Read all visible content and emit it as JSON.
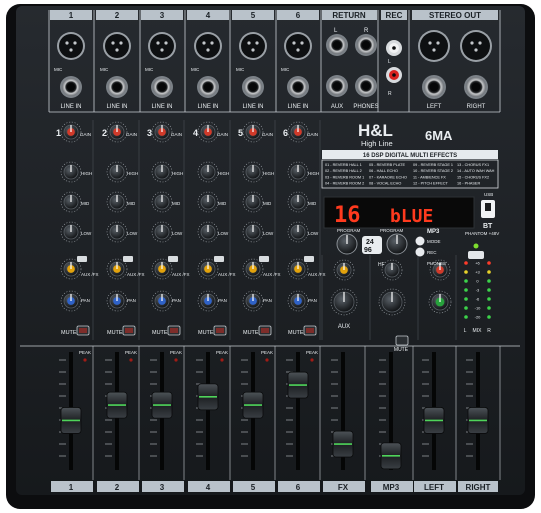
{
  "brand": {
    "logo": "H&L",
    "name": "High Line",
    "model": "6MA"
  },
  "top_labels": {
    "channels": [
      "1",
      "2",
      "3",
      "4",
      "5",
      "6"
    ],
    "return": "RETURN",
    "rec": "REC",
    "stereo_out": "STEREO OUT"
  },
  "jack_labels": {
    "mic": "MIC",
    "line_in": "LINE IN",
    "aux": "AUX",
    "phones": "PHONES",
    "left": "LEFT",
    "right": "RIGHT",
    "rec_l": "L",
    "rec_r": "R"
  },
  "channel_strip": {
    "gain": "GAIN",
    "high": "HIGH",
    "mid": "MID",
    "low": "LOW",
    "aux_fx": "AUX /FX",
    "pan": "PAN",
    "mute": "MUTE",
    "peak": "PEAK"
  },
  "effects": {
    "title": "16 DSP DIGITAL MULTI EFFECTS",
    "list": [
      "01 - REVERB HALL 1",
      "02 - REVERB HALL 2",
      "03 - REVERB ROOM 1",
      "04 - REVERB ROOM 2",
      "05 - REVERB PLATE",
      "06 - HALL ECHO",
      "07 - KARAOKE ECHO",
      "08 - VOCAL ECHO",
      "09 - REVERB STAGE 1",
      "10 - REVERB STAGE 2",
      "11 - AMBIENCE FX",
      "12 - PITCH EFFECT",
      "13 - CHORUS FX1",
      "14 - AUTO WAH WAH",
      "15 - CHORUS FX2",
      "16 - PHASER"
    ]
  },
  "display": {
    "preset": "16",
    "mode": "bLUE"
  },
  "controls": {
    "program_left": "PROGRAM",
    "program_right": "PROGRAM",
    "mp3": "MP3",
    "mode": "MODE",
    "rec": "REC",
    "usb": "USB",
    "bt": "BT",
    "phantom": "PHANTOM +48V",
    "aux": "AUX",
    "phones": "PHONES",
    "hf": "HF",
    "db24": "24",
    "bit96": "96"
  },
  "meter": {
    "labels": [
      "+6",
      "+3",
      "0",
      "-3",
      "-6",
      "-10",
      "-20"
    ],
    "footer": [
      "L",
      "MIX",
      "R"
    ]
  },
  "bottom_labels": [
    "1",
    "2",
    "3",
    "4",
    "5",
    "6",
    "FX",
    "MP3",
    "LEFT",
    "RIGHT"
  ],
  "fader_levels": [
    0.42,
    0.55,
    0.55,
    0.62,
    0.55,
    0.72,
    0.22,
    0.12,
    0.42,
    0.42
  ],
  "colors": {
    "panel": "#1c2024",
    "panel_edge": "#2b3035",
    "label_strip": "#b9c2ca",
    "gain_knob": "#d13a2a",
    "aux_knob": "#e2a20c",
    "pan_knob": "#2f62c8",
    "fx_knob": "#e2a20c",
    "display_red": "#ff3a1e",
    "meter_green": "#3cd24a",
    "meter_yellow": "#e8d22a",
    "meter_red": "#ff3b2a"
  }
}
